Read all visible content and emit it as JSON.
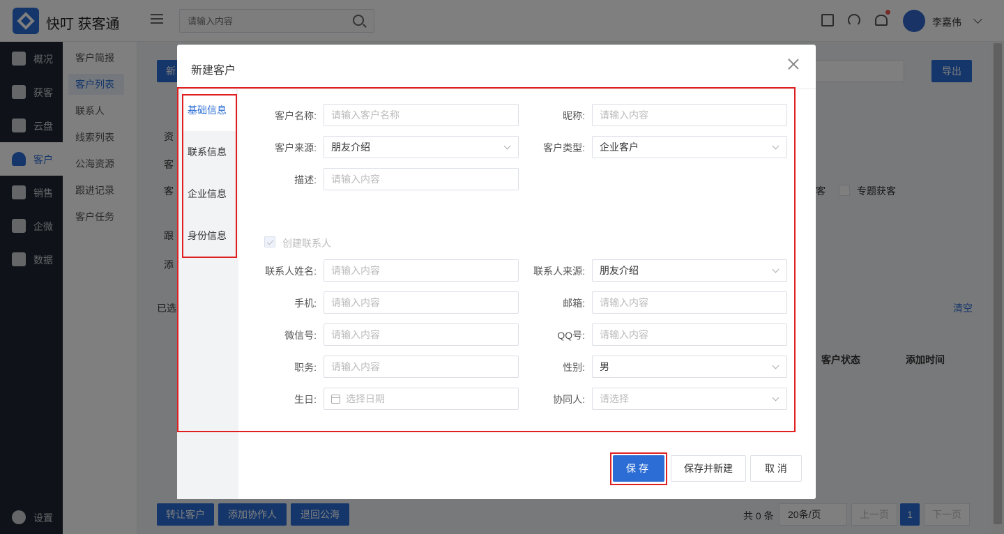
{
  "app": {
    "title": "快叮 获客通"
  },
  "header": {
    "search_placeholder": "请输入内容",
    "username": "李嘉伟"
  },
  "sidebar": {
    "items": [
      {
        "label": "概况",
        "icon": "monitor-icon"
      },
      {
        "label": "获客",
        "icon": "share-icon"
      },
      {
        "label": "云盘",
        "icon": "grid-icon"
      },
      {
        "label": "客户",
        "icon": "user-icon"
      },
      {
        "label": "销售",
        "icon": "clipboard-icon"
      },
      {
        "label": "企微",
        "icon": "person-icon"
      },
      {
        "label": "数据",
        "icon": "bar-chart-icon"
      }
    ],
    "settings_label": "设置",
    "active": "客户"
  },
  "submenu": {
    "items": [
      "客户简报",
      "客户列表",
      "联系人",
      "线索列表",
      "公海资源",
      "跟进记录",
      "客户任务"
    ],
    "active": "客户列表"
  },
  "background": {
    "new_button": "新",
    "export_button": "导出",
    "row_labels": [
      "资",
      "客",
      "客",
      "跟",
      "添"
    ],
    "topic_checkbox": "专题获客",
    "topic_partial": "客",
    "selected_prefix": "已选",
    "clear_link": "清空",
    "table_headers": [
      "客户状态",
      "添加时间"
    ],
    "bottom_buttons": [
      "转让客户",
      "添加协作人",
      "退回公海"
    ],
    "pagination": {
      "total": "共 0 条",
      "page_size": "20条/页",
      "prev": "上一页",
      "current": "1",
      "next": "下一页"
    }
  },
  "modal": {
    "title": "新建客户",
    "tabs": [
      "基础信息",
      "联系信息",
      "企业信息",
      "身份信息"
    ],
    "active_tab": "基础信息",
    "fields": {
      "customer_name": {
        "label": "客户名称:",
        "placeholder": "请输入客户名称"
      },
      "nickname": {
        "label": "昵称:",
        "placeholder": "请输入内容"
      },
      "customer_source": {
        "label": "客户来源:",
        "value": "朋友介绍"
      },
      "customer_type": {
        "label": "客户类型:",
        "value": "企业客户"
      },
      "description": {
        "label": "描述:",
        "placeholder": "请输入内容"
      }
    },
    "create_contact": {
      "label": "创建联系人",
      "checked": true
    },
    "contact_fields": {
      "contact_name": {
        "label": "联系人姓名:",
        "placeholder": "请输入内容"
      },
      "contact_source": {
        "label": "联系人来源:",
        "value": "朋友介绍"
      },
      "mobile": {
        "label": "手机:",
        "placeholder": "请输入内容"
      },
      "email": {
        "label": "邮箱:",
        "placeholder": "请输入内容"
      },
      "wechat": {
        "label": "微信号:",
        "placeholder": "请输入内容"
      },
      "qq": {
        "label": "QQ号:",
        "placeholder": "请输入内容"
      },
      "position": {
        "label": "职务:",
        "placeholder": "请输入内容"
      },
      "gender": {
        "label": "性别:",
        "value": "男"
      },
      "birthday": {
        "label": "生日:",
        "placeholder": "选择日期"
      },
      "collaborator": {
        "label": "协同人:",
        "placeholder": "请选择"
      }
    },
    "buttons": {
      "save": "保存",
      "save_and_new": "保存并新建",
      "cancel": "取 消"
    }
  },
  "colors": {
    "primary": "#2b6dd4",
    "highlight": "#e02020",
    "sidebar_bg": "#1f2633"
  }
}
